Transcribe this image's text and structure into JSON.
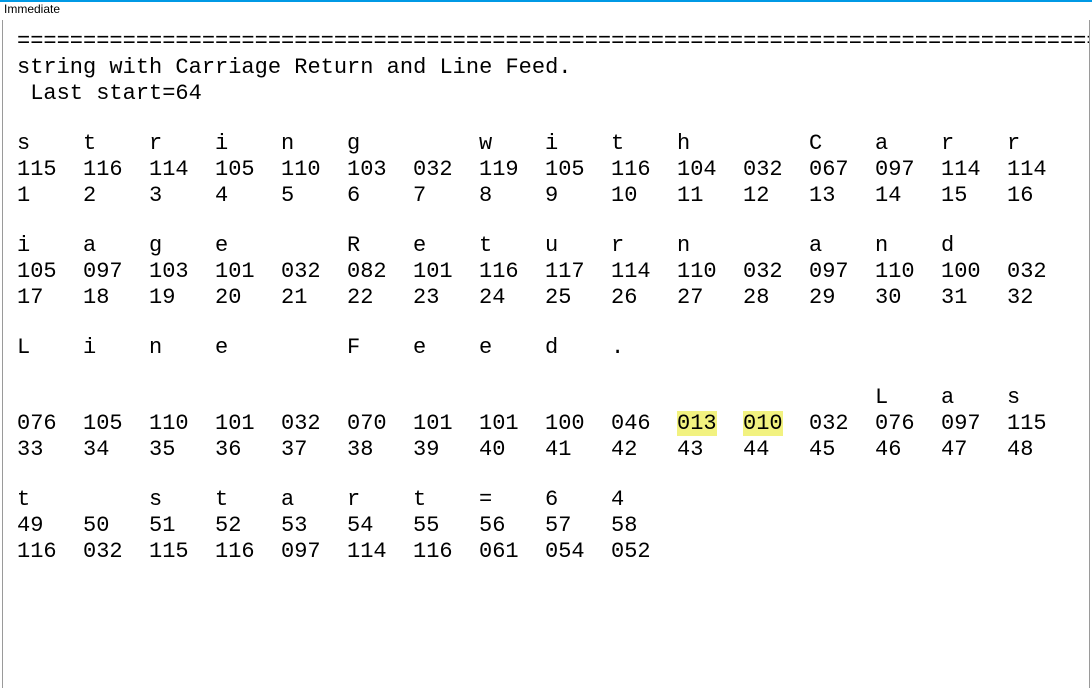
{
  "window": {
    "title": "Immediate"
  },
  "divider": "==================================================================================",
  "header": {
    "line1": "string with Carriage Return and Line Feed.",
    "line2": " Last start=64"
  },
  "blocks": [
    {
      "chars": [
        "s",
        "t",
        "r",
        "i",
        "n",
        "g",
        "",
        "w",
        "i",
        "t",
        "h",
        "",
        "C",
        "a",
        "r",
        "r"
      ],
      "codes": [
        "115",
        "116",
        "114",
        "105",
        "110",
        "103",
        "032",
        "119",
        "105",
        "116",
        "104",
        "032",
        "067",
        "097",
        "114",
        "114"
      ],
      "index": [
        "1",
        "2",
        "3",
        "4",
        "5",
        "6",
        "7",
        "8",
        "9",
        "10",
        "11",
        "12",
        "13",
        "14",
        "15",
        "16"
      ]
    },
    {
      "chars": [
        "i",
        "a",
        "g",
        "e",
        "",
        "R",
        "e",
        "t",
        "u",
        "r",
        "n",
        "",
        "a",
        "n",
        "d",
        ""
      ],
      "codes": [
        "105",
        "097",
        "103",
        "101",
        "032",
        "082",
        "101",
        "116",
        "117",
        "114",
        "110",
        "032",
        "097",
        "110",
        "100",
        "032"
      ],
      "index": [
        "17",
        "18",
        "19",
        "20",
        "21",
        "22",
        "23",
        "24",
        "25",
        "26",
        "27",
        "28",
        "29",
        "30",
        "31",
        "32"
      ]
    },
    {
      "chars": [
        "L",
        "i",
        "n",
        "e",
        "",
        "F",
        "e",
        "e",
        "d",
        "."
      ],
      "chars2": [
        "",
        "",
        "",
        "",
        "",
        "",
        "",
        "",
        "",
        "",
        "",
        "",
        "",
        "L",
        "a",
        "s"
      ],
      "codes": [
        "076",
        "105",
        "110",
        "101",
        "032",
        "070",
        "101",
        "101",
        "100",
        "046",
        "013",
        "010",
        "032",
        "076",
        "097",
        "115"
      ],
      "highlight_codes": [
        10,
        11
      ],
      "index": [
        "33",
        "34",
        "35",
        "36",
        "37",
        "38",
        "39",
        "40",
        "41",
        "42",
        "43",
        "44",
        "45",
        "46",
        "47",
        "48"
      ]
    },
    {
      "chars": [
        "t",
        "",
        "s",
        "t",
        "a",
        "r",
        "t",
        "=",
        "6",
        "4"
      ],
      "index": [
        "49",
        "50",
        "51",
        "52",
        "53",
        "54",
        "55",
        "56",
        "57",
        "58"
      ],
      "codes": [
        "116",
        "032",
        "115",
        "116",
        "097",
        "114",
        "116",
        "061",
        "054",
        "052"
      ]
    }
  ]
}
